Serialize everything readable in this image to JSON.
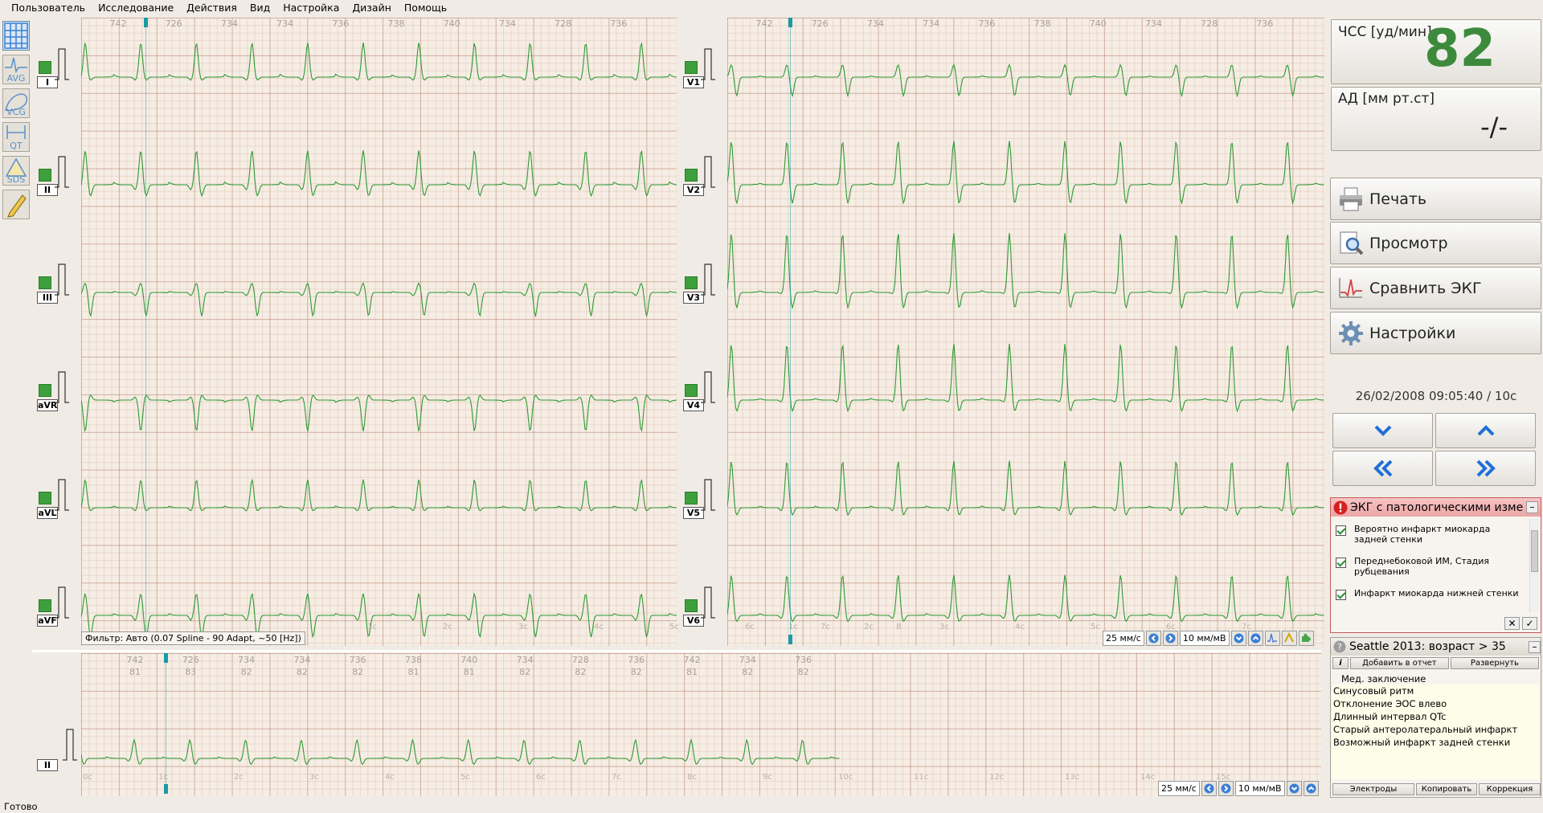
{
  "menu": [
    "Пользователь",
    "Исследование",
    "Действия",
    "Вид",
    "Настройка",
    "Дизайн",
    "Помощь"
  ],
  "tools": [
    {
      "name": "grid-icon",
      "label": ""
    },
    {
      "name": "avg-icon",
      "label": "AVG"
    },
    {
      "name": "vcg-icon",
      "label": "VCG"
    },
    {
      "name": "qt-icon",
      "label": "QT"
    },
    {
      "name": "sds-icon",
      "label": "SDS"
    },
    {
      "name": "pencil-icon",
      "label": ""
    }
  ],
  "leads_left": [
    "I",
    "II",
    "III",
    "aVR",
    "aVL",
    "aVF"
  ],
  "leads_right": [
    "V1",
    "V2",
    "V3",
    "V4",
    "V5",
    "V6"
  ],
  "rr_top": [
    "742",
    "726",
    "734",
    "734",
    "736",
    "738",
    "740",
    "734",
    "728",
    "736"
  ],
  "rr_top_right": [
    "742",
    "726",
    "734",
    "734",
    "736",
    "738",
    "740",
    "734",
    "728",
    "736"
  ],
  "time_left": [
    "1c",
    "2c",
    "3c",
    "4c",
    "5c",
    "6c",
    "7c",
    "8"
  ],
  "time_right": [
    "1c",
    "2c",
    "3c",
    "4c",
    "5c",
    "6c",
    "7c"
  ],
  "filter": "Фильтр: Авто (0.07 Spline - 90 Adapt, ~50 [Hz])",
  "controls": {
    "speed": "25 мм/с",
    "gain": "10 мм/мВ"
  },
  "rhythm": {
    "lead": "II",
    "rr": [
      "742",
      "726",
      "734",
      "734",
      "736",
      "738",
      "740",
      "734",
      "728",
      "736",
      "742",
      "734",
      "736"
    ],
    "hr": [
      "81",
      "83",
      "82",
      "82",
      "82",
      "81",
      "81",
      "82",
      "82",
      "82",
      "81",
      "82",
      "82"
    ],
    "time": [
      "0c",
      "1c",
      "2c",
      "3c",
      "4c",
      "5c",
      "6c",
      "7c",
      "8c",
      "9c",
      "10c",
      "11c",
      "12c",
      "13c",
      "14c",
      "15c"
    ]
  },
  "vitals": {
    "hr_label": "ЧСС [уд/мин]",
    "hr_value": "82",
    "bp_label": "АД [мм рт.ст]",
    "bp_value": "-/-"
  },
  "actions": [
    {
      "label": "Печать",
      "icon": "printer-icon"
    },
    {
      "label": "Просмотр",
      "icon": "preview-icon"
    },
    {
      "label": "Сравнить ЭКГ",
      "icon": "compare-ecg-icon"
    },
    {
      "label": "Настройки",
      "icon": "gear-icon"
    }
  ],
  "datetime": "26/02/2008 09:05:40 / 10с",
  "diagnosis": {
    "title": "ЭКГ с патологическими измене",
    "items": [
      "Вероятно инфаркт миокарда задней стенки",
      "Переднебоковой ИМ, Стадия рубцевания",
      "Инфаркт миокарда нижней стенки"
    ]
  },
  "seattle": {
    "title": "Seattle 2013: возраст > 35",
    "add_btn": "Добавить в отчет",
    "expand_btn": "Развернуть",
    "conclusion_title": "Мед. заключение",
    "lines": [
      "Синусовый ритм",
      "Отклонение ЭОС влево",
      "Длинный интервал QTc",
      "Старый антеролатеральный инфаркт",
      "Возможный инфаркт задней стенки"
    ],
    "bottom_btns": [
      "Электроды",
      "Копировать",
      "Коррекция"
    ]
  },
  "status": "Готово",
  "colors": {
    "trace": "#2f9a36",
    "grid_major": "#c9a596",
    "grid_bg": "#f6ede4",
    "hr_value": "#3d8a3d",
    "alert": "#d42020"
  }
}
